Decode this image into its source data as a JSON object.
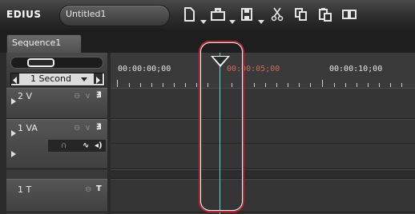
{
  "app": {
    "logo": "EDIUS",
    "project_name": "Untitled1"
  },
  "toolbar": {
    "icons": [
      "new-project-icon",
      "open-project-icon",
      "save-project-icon",
      "cut-icon",
      "copy-icon",
      "paste-icon",
      "clip-icon"
    ]
  },
  "sequence_tab": {
    "label": "Sequence1"
  },
  "timescale": {
    "value": "1 Second"
  },
  "ruler": {
    "timecodes": [
      "00:00:00;00",
      "00:00:05;00",
      "00:00:10;00"
    ]
  },
  "tracks": [
    {
      "label": "2 V"
    },
    {
      "label": "1 VA"
    },
    {
      "label": "1 T"
    }
  ],
  "colors": {
    "highlight": "#c0262f",
    "playhead": "#57d7df",
    "current_timecode": "#d06a5a"
  }
}
